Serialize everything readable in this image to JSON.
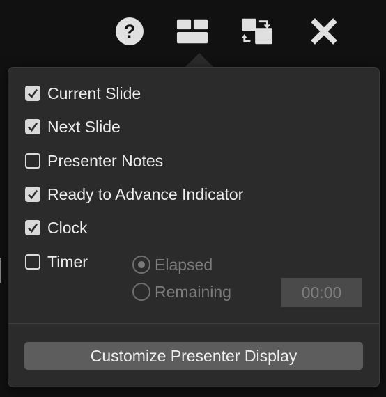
{
  "toolbar": {
    "icons": [
      {
        "name": "help-icon"
      },
      {
        "name": "layout-icon"
      },
      {
        "name": "swap-displays-icon"
      },
      {
        "name": "close-icon"
      }
    ],
    "icon_color": "#e0e0e0"
  },
  "options": [
    {
      "label": "Current Slide",
      "checked": true
    },
    {
      "label": "Next Slide",
      "checked": true
    },
    {
      "label": "Presenter Notes",
      "checked": false
    },
    {
      "label": "Ready to Advance Indicator",
      "checked": true
    },
    {
      "label": "Clock",
      "checked": true
    },
    {
      "label": "Timer",
      "checked": false
    }
  ],
  "timer": {
    "modes": [
      {
        "label": "Elapsed",
        "selected": true
      },
      {
        "label": "Remaining",
        "selected": false
      }
    ],
    "value": "00:00",
    "enabled": false
  },
  "customize_button": {
    "label": "Customize Presenter Display"
  }
}
